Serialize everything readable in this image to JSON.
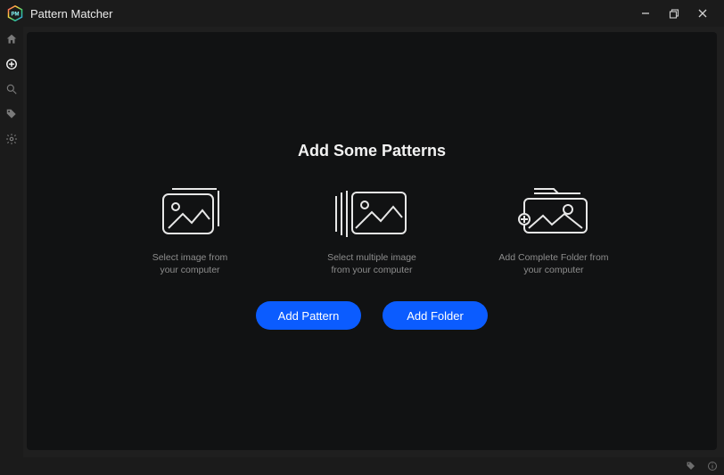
{
  "app": {
    "title": "Pattern Matcher"
  },
  "sidebar": {
    "items": [
      {
        "name": "home"
      },
      {
        "name": "add",
        "active": true
      },
      {
        "name": "search"
      },
      {
        "name": "tag"
      },
      {
        "name": "settings"
      }
    ]
  },
  "main": {
    "heading": "Add Some Patterns",
    "cards": [
      {
        "caption_line1": "Select image from",
        "caption_line2": "your computer"
      },
      {
        "caption_line1": "Select multiple image",
        "caption_line2": "from your computer"
      },
      {
        "caption_line1": "Add Complete Folder from",
        "caption_line2": "your computer"
      }
    ],
    "buttons": {
      "add_pattern": "Add Pattern",
      "add_folder": "Add Folder"
    }
  },
  "colors": {
    "accent": "#0b5cff",
    "bg_window": "#1b1b1b",
    "bg_canvas": "#111213",
    "text_muted": "#8d8d8d"
  }
}
